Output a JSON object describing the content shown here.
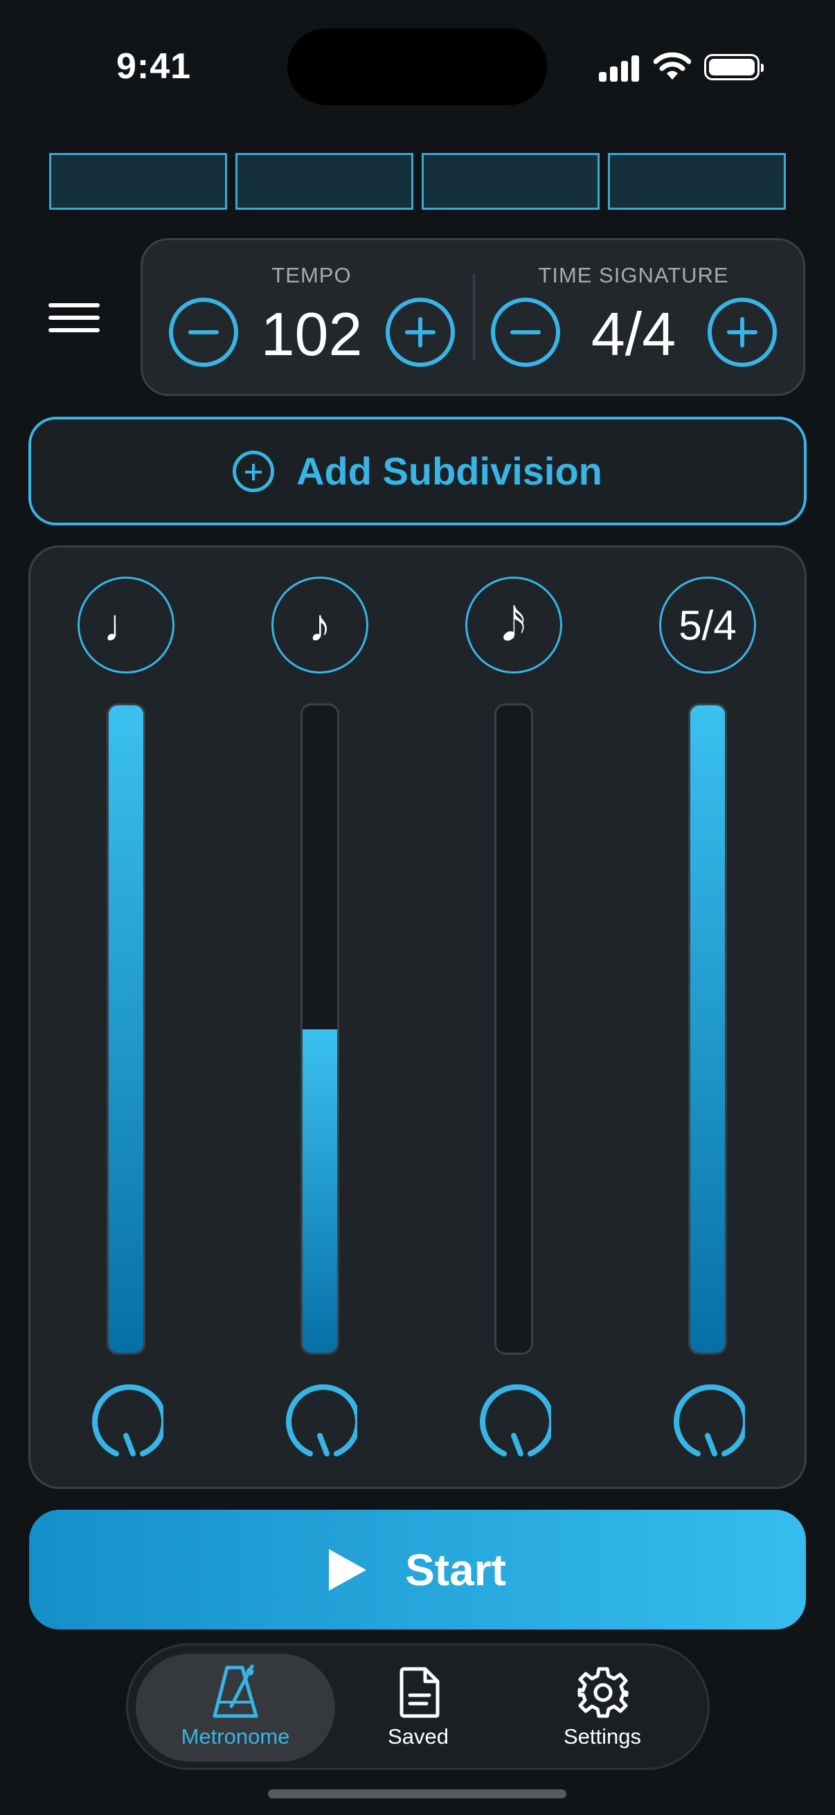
{
  "status_bar": {
    "time": "9:41"
  },
  "beats": [
    {
      "id": 1
    },
    {
      "id": 2
    },
    {
      "id": 3
    },
    {
      "id": 4
    }
  ],
  "tempo": {
    "label": "TEMPO",
    "value": "102"
  },
  "time_signature": {
    "label": "TIME SIGNATURE",
    "value": "4/4"
  },
  "add_subdivision": {
    "label": "Add Subdivision"
  },
  "tracks": [
    {
      "name": "quarter-note",
      "symbol": "♩",
      "level": 1.0
    },
    {
      "name": "eighth-note",
      "symbol": "♪",
      "level": 0.5
    },
    {
      "name": "sixteenth-note",
      "symbol": "𝅘𝅥𝅯",
      "level": 0.0
    },
    {
      "name": "polyrhythm",
      "symbol": "5/4",
      "level": 1.0
    }
  ],
  "start_button": {
    "label": "Start"
  },
  "tabs": [
    {
      "label": "Metronome",
      "icon": "metronome-icon",
      "active": true
    },
    {
      "label": "Saved",
      "icon": "document-icon",
      "active": false
    },
    {
      "label": "Settings",
      "icon": "gear-icon",
      "active": false
    }
  ],
  "colors": {
    "accent": "#36b5e6",
    "background": "#111417",
    "panel": "#1f2428"
  }
}
